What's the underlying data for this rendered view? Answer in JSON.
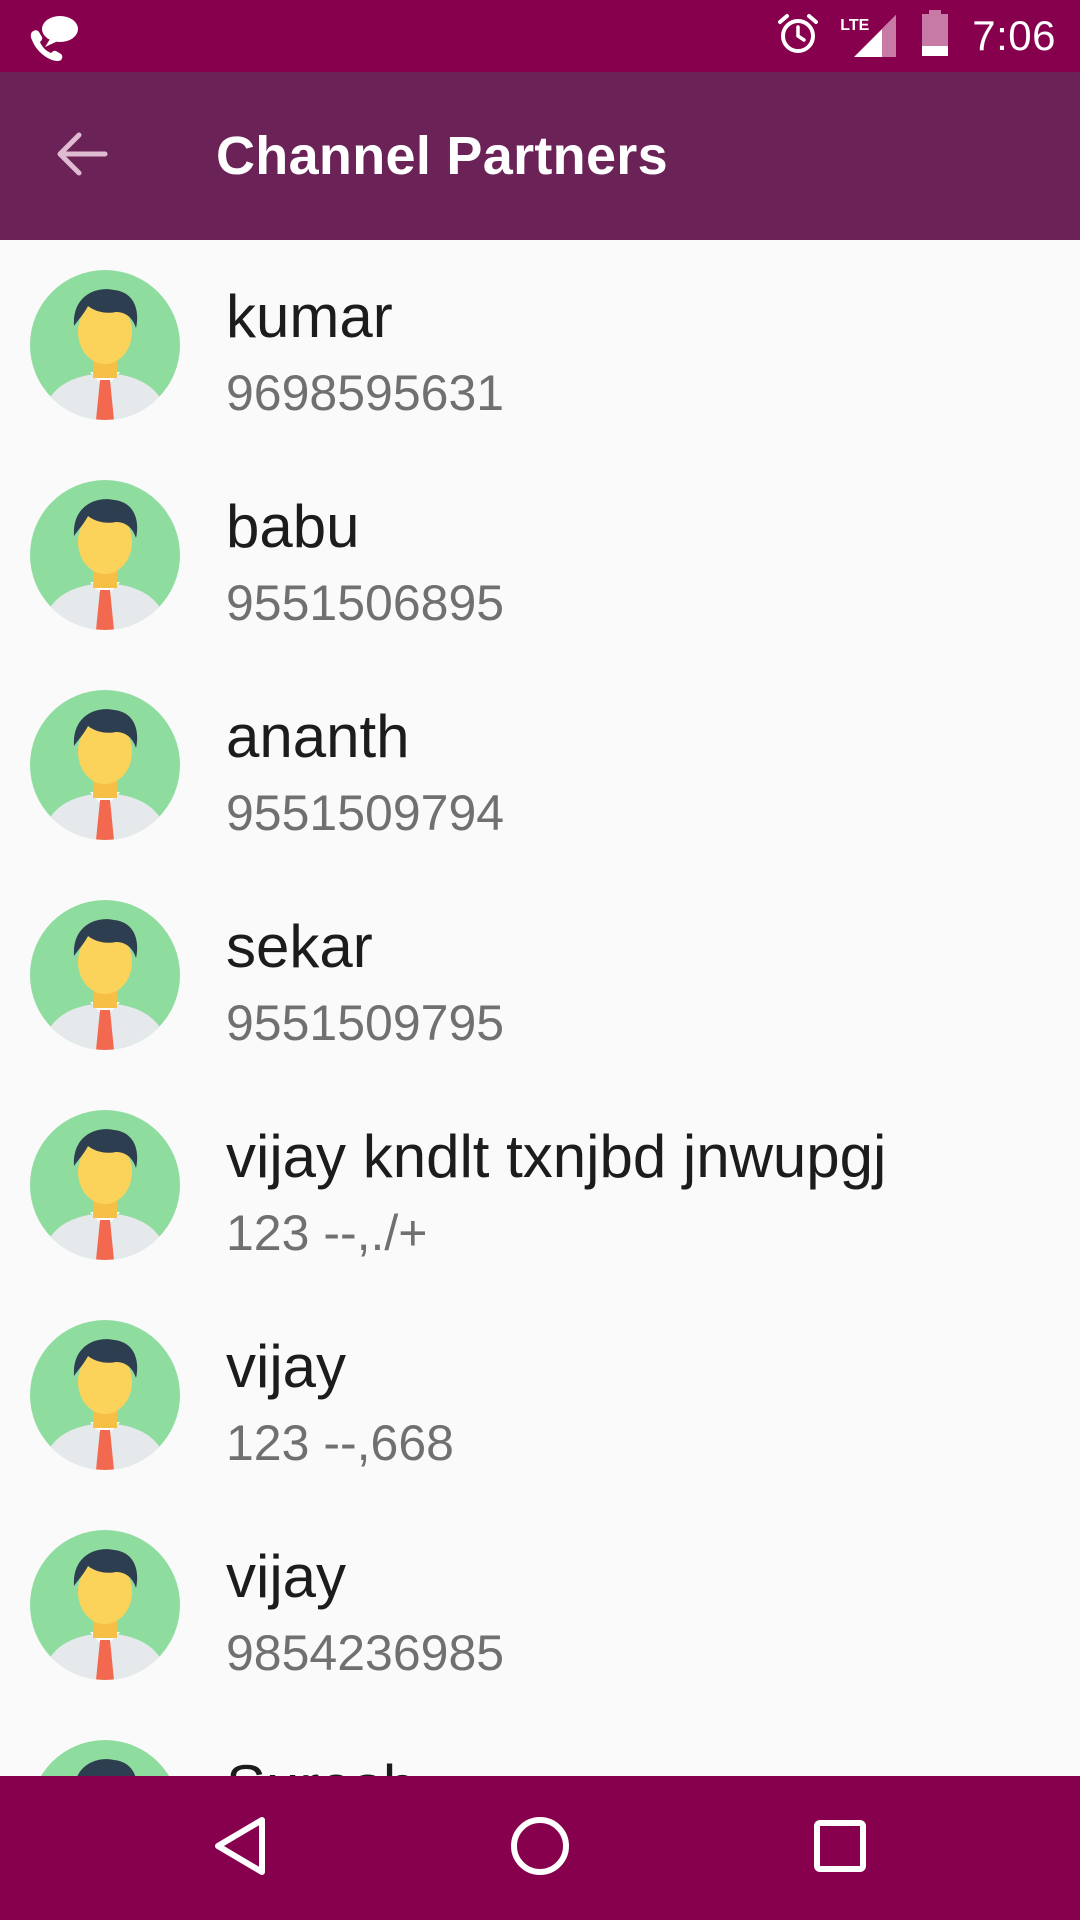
{
  "status_bar": {
    "time": "7:06",
    "network_label": "LTE",
    "icons": [
      "call-message-icon",
      "alarm-icon",
      "signal-icon",
      "battery-icon"
    ]
  },
  "app_bar": {
    "title": "Channel Partners",
    "back_icon": "arrow-back-icon"
  },
  "partners": [
    {
      "name": "kumar",
      "phone": "9698595631"
    },
    {
      "name": "babu",
      "phone": "9551506895"
    },
    {
      "name": "ananth",
      "phone": "9551509794"
    },
    {
      "name": "sekar",
      "phone": "9551509795"
    },
    {
      "name": "vijay kndlt txnjbd jnwupgj",
      "phone": "123 --,./+"
    },
    {
      "name": "vijay",
      "phone": "123 --,668"
    },
    {
      "name": "vijay",
      "phone": "9854236985"
    },
    {
      "name": "Suresh",
      "phone": ""
    }
  ],
  "nav_bar": {
    "buttons": [
      "back-triangle-icon",
      "home-circle-icon",
      "recents-square-icon"
    ]
  },
  "colors": {
    "status_bar": "#86004d",
    "app_bar": "#6b2257",
    "nav_bar": "#86004d",
    "background": "#fafafa",
    "name_text": "#1c1c1c",
    "phone_text": "#707070",
    "avatar_bg": "#8fdc9f"
  }
}
